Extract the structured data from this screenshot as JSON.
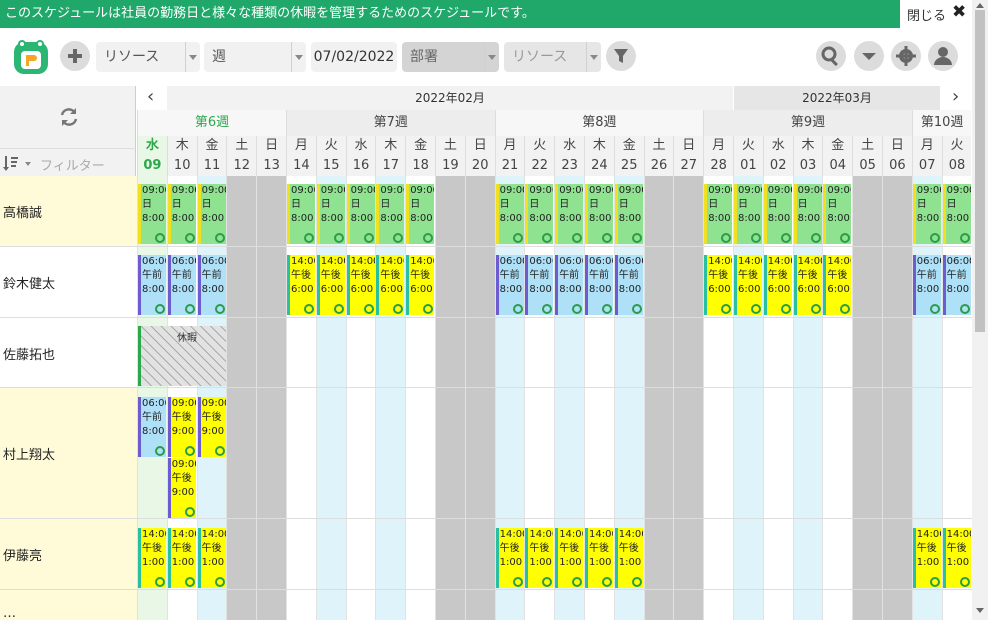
{
  "banner": {
    "text": "このスケジュールは社員の勤務日と様々な種類の休暇を管理するためのスケジュールです。",
    "close_label": "閉じる",
    "close_icon": "✖"
  },
  "toolbar": {
    "resource_select": "リソース",
    "view_select": "週",
    "date": "07/02/2022",
    "dept_select": "部署",
    "resource_filter": "リソース"
  },
  "grid": {
    "months": [
      {
        "label": "2022年02月"
      },
      {
        "label": "2022年03月"
      }
    ],
    "weeks": [
      "第6週",
      "第7週",
      "第8週",
      "第9週",
      "第10週"
    ],
    "days": [
      {
        "dow": "水",
        "d": "09"
      },
      {
        "dow": "木",
        "d": "10"
      },
      {
        "dow": "金",
        "d": "11"
      },
      {
        "dow": "土",
        "d": "12"
      },
      {
        "dow": "日",
        "d": "13"
      },
      {
        "dow": "月",
        "d": "14"
      },
      {
        "dow": "火",
        "d": "15"
      },
      {
        "dow": "水",
        "d": "16"
      },
      {
        "dow": "木",
        "d": "17"
      },
      {
        "dow": "金",
        "d": "18"
      },
      {
        "dow": "土",
        "d": "19"
      },
      {
        "dow": "日",
        "d": "20"
      },
      {
        "dow": "月",
        "d": "21"
      },
      {
        "dow": "火",
        "d": "22"
      },
      {
        "dow": "水",
        "d": "23"
      },
      {
        "dow": "木",
        "d": "24"
      },
      {
        "dow": "金",
        "d": "25"
      },
      {
        "dow": "土",
        "d": "26"
      },
      {
        "dow": "日",
        "d": "27"
      },
      {
        "dow": "月",
        "d": "28"
      },
      {
        "dow": "火",
        "d": "01"
      },
      {
        "dow": "水",
        "d": "02"
      },
      {
        "dow": "木",
        "d": "03"
      },
      {
        "dow": "金",
        "d": "04"
      },
      {
        "dow": "土",
        "d": "05"
      },
      {
        "dow": "日",
        "d": "06"
      },
      {
        "dow": "月",
        "d": "07"
      },
      {
        "dow": "火",
        "d": "08"
      }
    ],
    "filter_placeholder": "フィルター",
    "resources": [
      "高橋誠",
      "鈴木健太",
      "佐藤拓也",
      "村上翔太",
      "伊藤亮",
      "…"
    ],
    "leave_label": "休暇",
    "shift_types": {
      "day9": {
        "l1": "09:00",
        "l2": "日",
        "l3": "8:00",
        "bg": "#8fe28f",
        "bar": "#f0e020"
      },
      "am6": {
        "l1": "06:00",
        "l2": "午前",
        "l3": "8:00",
        "bg": "#aee0f7",
        "bar": "#6d5ccf"
      },
      "pm2": {
        "l1": "14:00",
        "l2": "午後",
        "l3": "6:00",
        "bg": "#ffff00",
        "bar": "#28c0a0"
      },
      "pm9": {
        "l1": "09:00",
        "l2": "午後",
        "l3": "9:00",
        "bg": "#ffff00",
        "bar": "#6d5ccf"
      },
      "pm1": {
        "l1": "14:00",
        "l2": "午後",
        "l3": "1:00",
        "bg": "#ffff00",
        "bar": "#28c0a0"
      }
    },
    "colors": {
      "weekend": "#c8c8c8",
      "alt_col": "#dff3fb",
      "today": "#e9f7e6",
      "week_accent": "#2aa84a"
    }
  }
}
